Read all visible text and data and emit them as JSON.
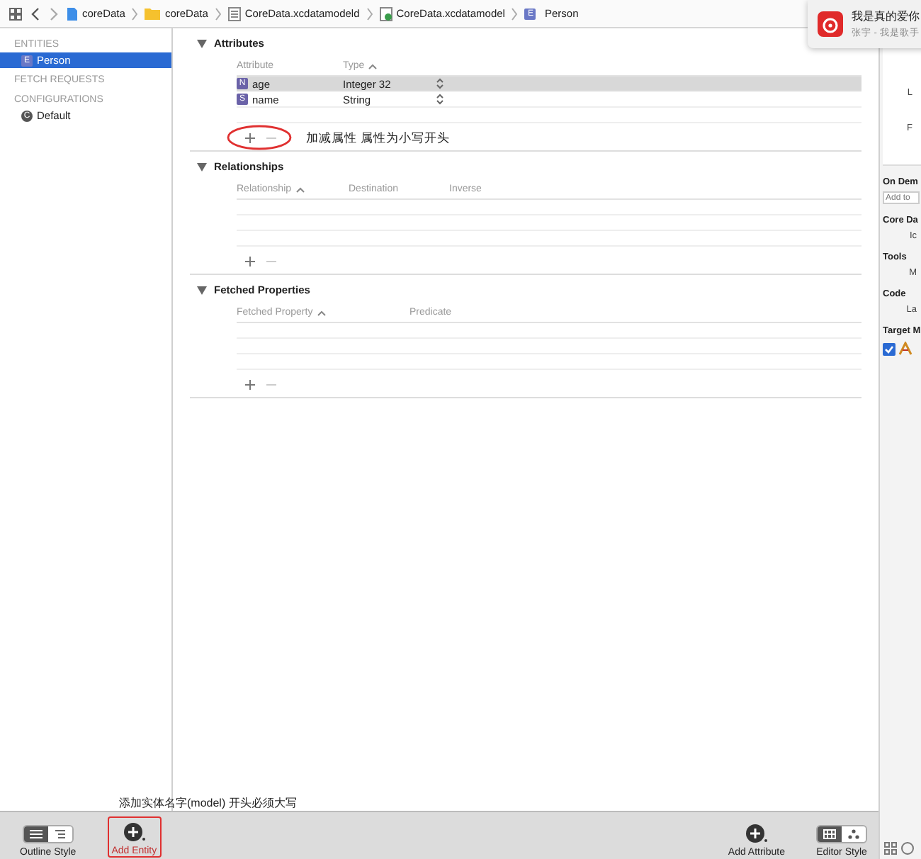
{
  "breadcrumb": [
    {
      "label": "coreData",
      "kind": "project"
    },
    {
      "label": "coreData",
      "kind": "folder"
    },
    {
      "label": "CoreData.xcdatamodeld",
      "kind": "bundle"
    },
    {
      "label": "CoreData.xcdatamodel",
      "kind": "model"
    },
    {
      "label": "Person",
      "kind": "entity",
      "badge": "E"
    }
  ],
  "notification": {
    "title": "我是真的爱你",
    "subtitle": "张宇 - 我是歌手"
  },
  "sidebar": {
    "sections": [
      {
        "title": "ENTITIES",
        "items": [
          {
            "label": "Person",
            "badge": "E",
            "selected": true
          }
        ]
      },
      {
        "title": "FETCH REQUESTS"
      },
      {
        "title": "CONFIGURATIONS",
        "items": [
          {
            "label": "Default",
            "badge": "C",
            "selected": false
          }
        ]
      }
    ]
  },
  "attributes": {
    "title": "Attributes",
    "columns": [
      {
        "label": "Attribute",
        "sorted": false
      },
      {
        "label": "Type",
        "sorted": true
      }
    ],
    "rows": [
      {
        "name": "age",
        "badge": "N",
        "type": "Integer 32",
        "selected": true
      },
      {
        "name": "name",
        "badge": "S",
        "type": "String",
        "selected": false
      }
    ],
    "note": "加减属性 属性为小写开头"
  },
  "relationships": {
    "title": "Relationships",
    "columns": [
      {
        "label": "Relationship",
        "sorted": true
      },
      {
        "label": "Destination",
        "sorted": false
      },
      {
        "label": "Inverse",
        "sorted": false
      }
    ]
  },
  "fetched_properties": {
    "title": "Fetched Properties",
    "columns": [
      {
        "label": "Fetched Property",
        "sorted": true
      },
      {
        "label": "Predicate",
        "sorted": false
      }
    ]
  },
  "inspector": {
    "top_labels": [
      "L",
      "F"
    ],
    "on_demand_title": "On Dem",
    "tag_placeholder": "Add to",
    "core_data_title": "Core Da",
    "core_data_labels": [
      "Ic"
    ],
    "tools_title": "Tools",
    "tools_labels": [
      "M"
    ],
    "code_title": "Code",
    "code_labels": [
      "La"
    ],
    "target_title": "Target M",
    "target_checked": true
  },
  "bottom_bar": {
    "outline_modes": [
      {
        "kind": "list",
        "selected": true
      },
      {
        "kind": "indented",
        "selected": false
      }
    ],
    "editor_modes": [
      {
        "kind": "table",
        "selected": true
      },
      {
        "kind": "graph",
        "selected": false
      }
    ],
    "note": "添加实体名字(model) 开头必须大写",
    "outline_style": "Outline Style",
    "add_entity": "Add Entity",
    "add_attribute": "Add Attribute",
    "editor_style": "Editor Style"
  }
}
